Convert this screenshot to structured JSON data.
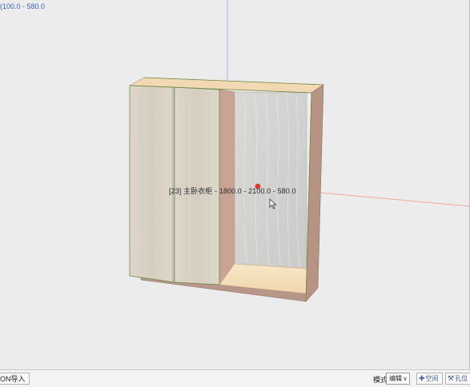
{
  "viewport": {
    "dimension_readout": "(100.0 - 580.0",
    "hover_label": "[23] 主卧衣柜 - 1800.0 - 2100.0 - 580.0"
  },
  "colors": {
    "door_panel": "#dcd5c8",
    "cabinet_edge": "#f1d9b8",
    "back_panel": "#d2d2d0",
    "side_panel": "#b8968a",
    "axis_blue": "#9fb3e0",
    "axis_red": "#f0a899",
    "selection_outline": "#6e8c44"
  },
  "statusbar": {
    "import_button": "ON导入",
    "mode_label": "模式",
    "mode_value": "编辑",
    "space_button": "空间",
    "hole_button": "孔位"
  }
}
